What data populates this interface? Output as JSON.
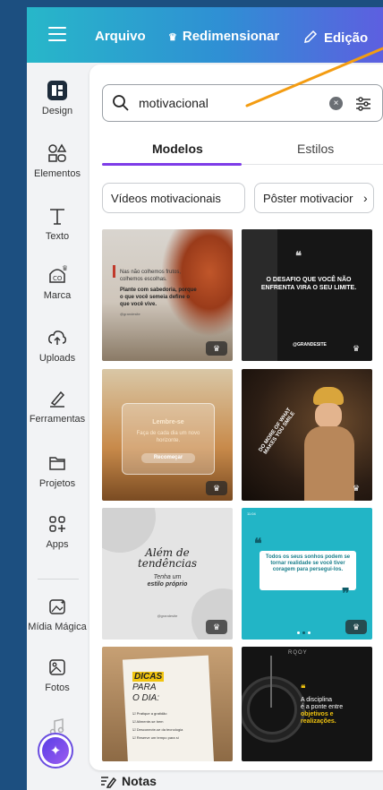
{
  "topbar": {
    "file_label": "Arquivo",
    "resize_label": "Redimensionar",
    "edit_label": "Edição"
  },
  "sidebar": {
    "items": [
      {
        "label": "Design"
      },
      {
        "label": "Elementos"
      },
      {
        "label": "Texto"
      },
      {
        "label": "Marca"
      },
      {
        "label": "Uploads"
      },
      {
        "label": "Ferramentas"
      },
      {
        "label": "Projetos"
      },
      {
        "label": "Apps"
      },
      {
        "label": "Mídia Mágica"
      },
      {
        "label": "Fotos"
      }
    ]
  },
  "search": {
    "value": "motivacional",
    "clear_label": "×"
  },
  "tabs": [
    {
      "label": "Modelos",
      "active": true
    },
    {
      "label": "Estilos",
      "active": false
    }
  ],
  "chips": [
    {
      "label": "Vídeos motivacionais"
    },
    {
      "label": "Pôster motivacior"
    }
  ],
  "templates": {
    "t1": {
      "line1": "Nas não colhemos frutos, colhemos escolhas.",
      "line2": "Plante com sabedoria, porque o que você semeia define o que você vive.",
      "handle": "@grandesite"
    },
    "t2": {
      "quote_mark": "❝",
      "text": "O DESAFIO QUE VOCÊ NÃO ENFRENTA VIRA O SEU LIMITE.",
      "handle": "@GRANDESITE"
    },
    "t3": {
      "title": "Lembre-se",
      "body": "Faça de cada dia um novo horizonte.",
      "button": "Recomeçar"
    },
    "t4": {
      "text": "DO MORE OF WHAT MAKES YOU SMILE"
    },
    "t5": {
      "line1": "Além de",
      "line2": "tendências",
      "line3": "Tenha um",
      "line4": "estilo próprio",
      "handle": "@grandesite"
    },
    "t6": {
      "time": "11:04",
      "quote_mark": "❝",
      "text": "Todos os seus sonhos podem se tornar realidade se você tiver coragem para persegui-los."
    },
    "t7": {
      "title1": "DICAS",
      "title2": "PARA",
      "title3": "O DIA:",
      "items": [
        "Pratique a gratidão",
        "Alimente-se bem",
        "Desconecte-se da tecnologia",
        "Reserve um tempo para si"
      ]
    },
    "t8": {
      "brand": "RQOY",
      "quote_mark": "❝",
      "line1": "A disciplina",
      "line2": "é a ponte entre",
      "line3": "objetivos e",
      "line4": "realizações."
    }
  },
  "premium_badge": "♛",
  "notes_label": "Notas",
  "colors": {
    "accent": "#7d3ce8",
    "topbar_start": "#27b7c9",
    "topbar_end": "#5d5fe0",
    "template_teal": "#22b5c6",
    "highlight_yellow": "#f1c40f"
  }
}
